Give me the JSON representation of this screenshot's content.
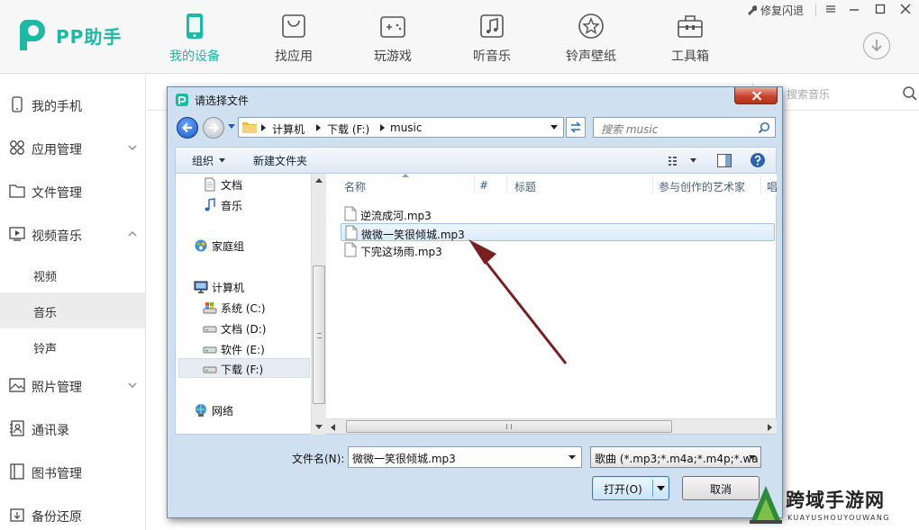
{
  "app": {
    "name": "PP助手",
    "brand_color": "#1fb8a4",
    "nav": [
      {
        "label": "我的设备",
        "icon": "phone-icon",
        "active": true
      },
      {
        "label": "找应用",
        "icon": "bag-icon",
        "active": false
      },
      {
        "label": "玩游戏",
        "icon": "gamepad-icon",
        "active": false
      },
      {
        "label": "听音乐",
        "icon": "music-note-icon",
        "active": false
      },
      {
        "label": "铃声壁纸",
        "icon": "star-icon",
        "active": false
      },
      {
        "label": "工具箱",
        "icon": "toolbox-icon",
        "active": false
      }
    ],
    "window": {
      "repair": "修复闪退"
    }
  },
  "sidebar": {
    "items": [
      {
        "label": "我的手机",
        "icon": "phone-outline-icon"
      },
      {
        "label": "应用管理",
        "icon": "apps-grid-icon",
        "chevron": "down"
      },
      {
        "label": "文件管理",
        "icon": "folder-icon"
      },
      {
        "label": "视频音乐",
        "icon": "media-icon",
        "chevron": "up"
      }
    ],
    "subitems": [
      {
        "label": "视频",
        "active": false
      },
      {
        "label": "音乐",
        "active": true
      },
      {
        "label": "铃声",
        "active": false
      }
    ],
    "items2": [
      {
        "label": "照片管理",
        "icon": "image-icon",
        "chevron": "down"
      },
      {
        "label": "通讯录",
        "icon": "contacts-icon"
      },
      {
        "label": "图书管理",
        "icon": "book-icon"
      },
      {
        "label": "备份还原",
        "icon": "backup-icon"
      }
    ]
  },
  "main": {
    "search_placeholder": "搜索音乐"
  },
  "dialog": {
    "title": "请选择文件",
    "address": {
      "crumbs": [
        "计算机",
        "下载 (F:)",
        "music"
      ]
    },
    "search_placeholder": "搜索 music",
    "toolbar": {
      "organize": "组织",
      "new_folder": "新建文件夹"
    },
    "nav_items": [
      {
        "label": "文档",
        "icon": "documents-icon"
      },
      {
        "label": "音乐",
        "icon": "music-icon"
      },
      {
        "label": "家庭组",
        "icon": "homegroup-icon"
      },
      {
        "label": "计算机",
        "icon": "computer-icon"
      },
      {
        "label": "系统 (C:)",
        "icon": "system-drive-icon"
      },
      {
        "label": "文档 (D:)",
        "icon": "drive-icon"
      },
      {
        "label": "软件 (E:)",
        "icon": "drive-icon"
      },
      {
        "label": "下载 (F:)",
        "icon": "drive-icon",
        "selected": true
      },
      {
        "label": "网络",
        "icon": "network-icon"
      }
    ],
    "columns": [
      "名称",
      "#",
      "标题",
      "参与创作的艺术家",
      "唱"
    ],
    "files": [
      {
        "name": "逆流成河.mp3",
        "selected": false
      },
      {
        "name": "微微一笑很倾城.mp3",
        "selected": true
      },
      {
        "name": "下完这场雨.mp3",
        "selected": false
      }
    ],
    "filename_label": "文件名(N):",
    "filename_value": "微微一笑很倾城.mp3",
    "filetype_value": "歌曲 (*.mp3;*.m4a;*.m4p;*.wa",
    "open_label": "打开(O)",
    "cancel_label": "取消"
  },
  "watermark": {
    "title": "跨域手游网",
    "subtitle": "KUAYUSHOUYOUWANG"
  },
  "colors": {
    "accent": "#1fb8a4",
    "arrow": "#7a1f1f",
    "dialog_frame": "#cfe0f1",
    "close_button": "#c7442e"
  }
}
